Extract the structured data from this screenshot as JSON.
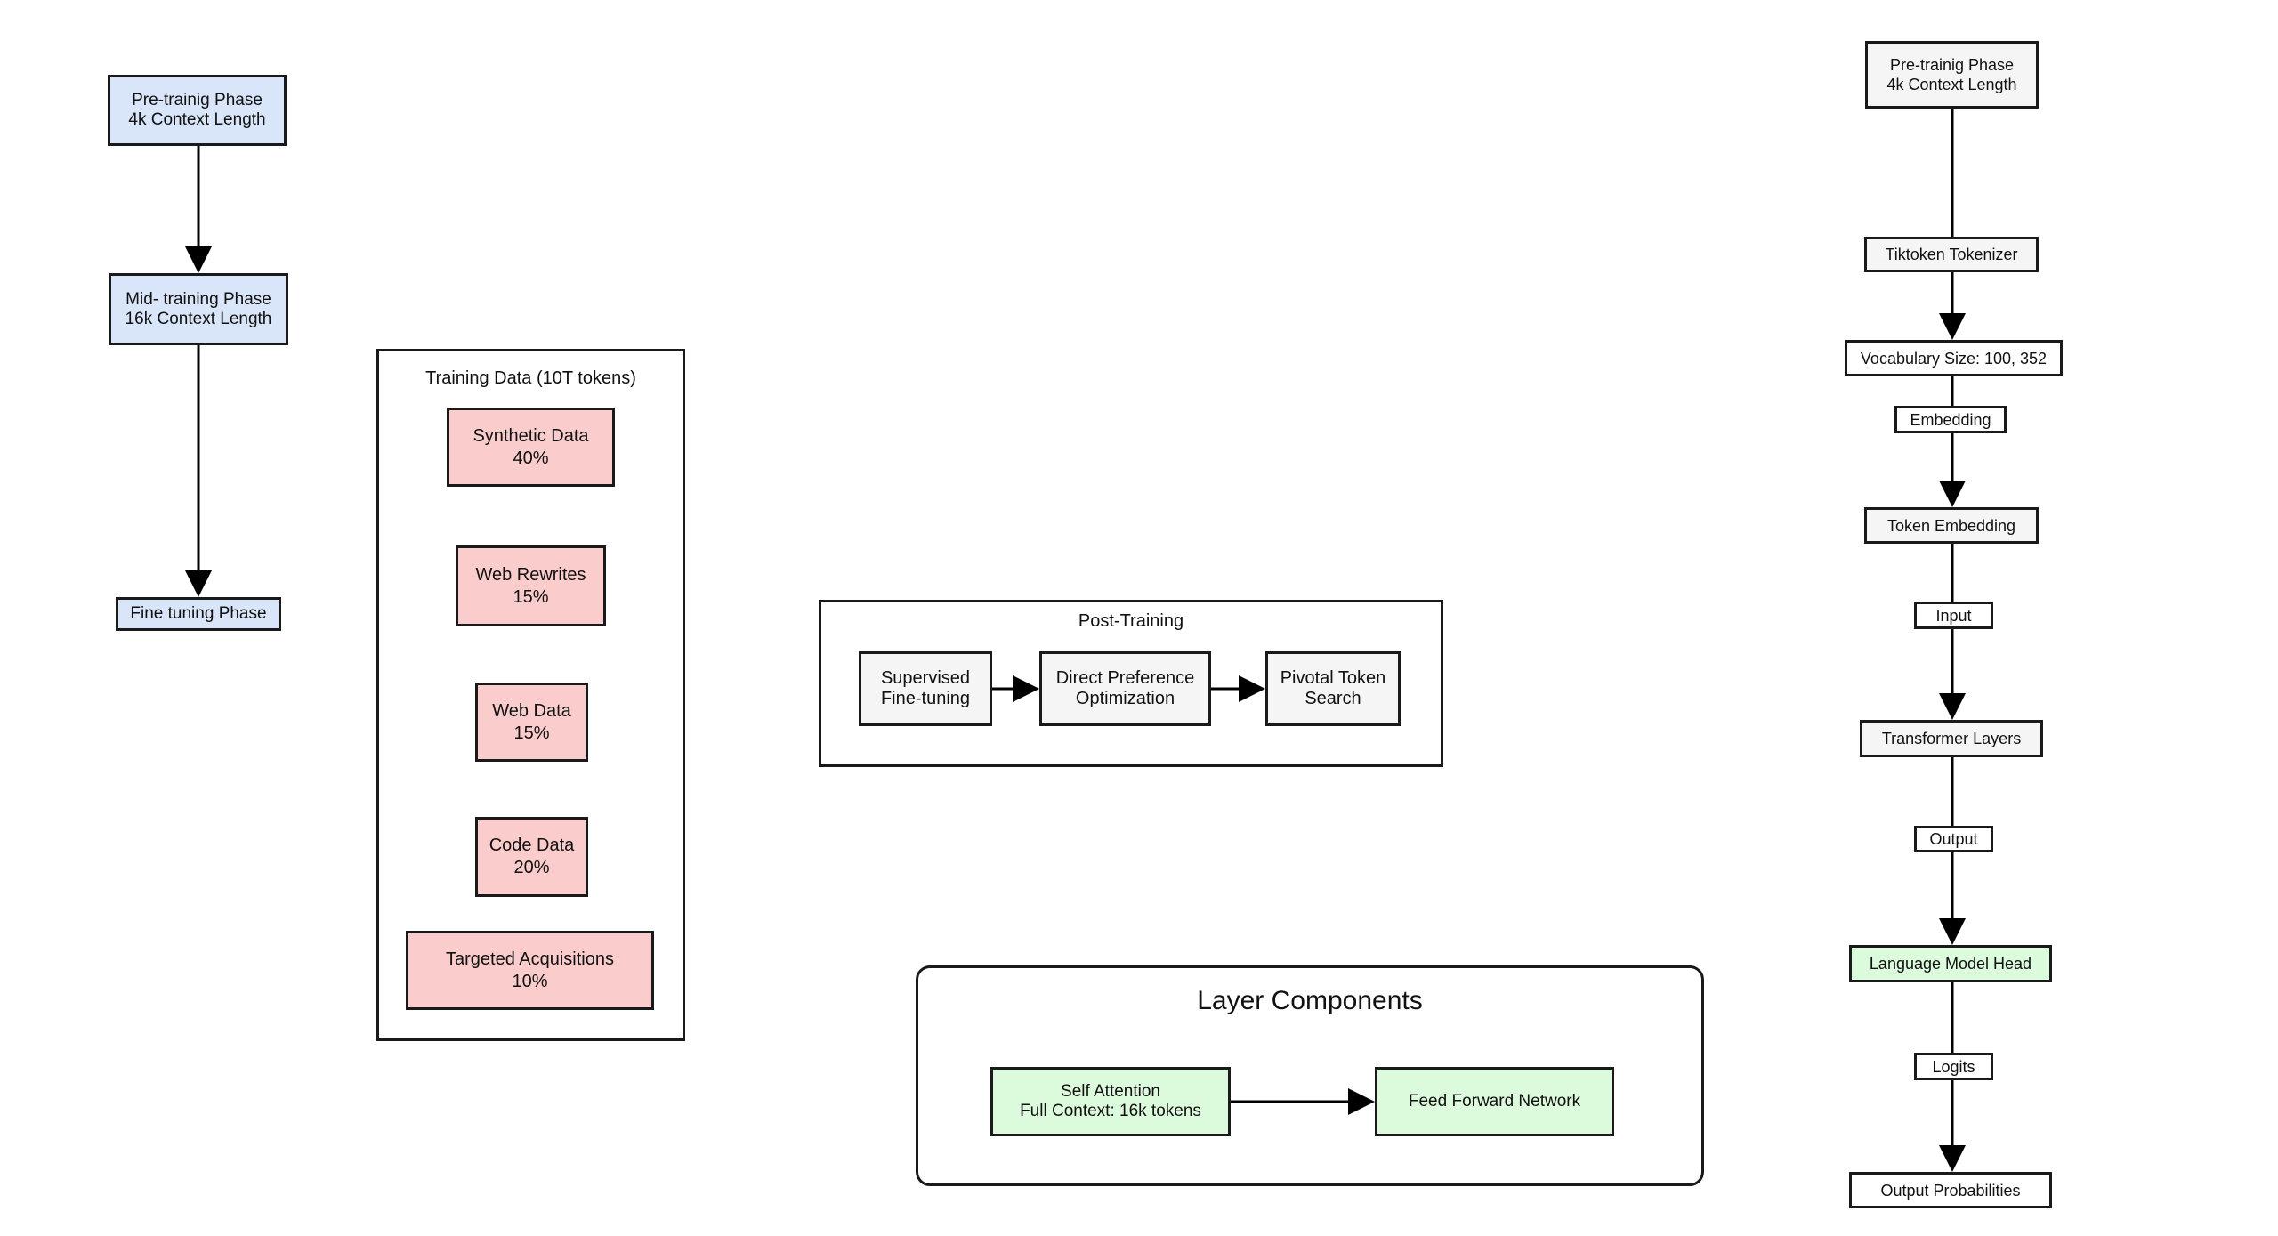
{
  "phases": {
    "pretraining": [
      "Pre-trainig Phase",
      "4k Context Length"
    ],
    "midtraining": [
      "Mid- training Phase",
      "16k Context Length"
    ],
    "finetuning": "Fine tuning Phase"
  },
  "training_data": {
    "title": "Training Data (10T tokens)",
    "items": [
      {
        "name": "Synthetic Data",
        "share": "40%"
      },
      {
        "name": "Web Rewrites",
        "share": "15%"
      },
      {
        "name": "Web Data",
        "share": "15%"
      },
      {
        "name": "Code Data",
        "share": "20%"
      },
      {
        "name": "Targeted Acquisitions",
        "share": "10%"
      }
    ]
  },
  "post_training": {
    "title": "Post-Training",
    "steps": [
      [
        "Supervised",
        "Fine-tuning"
      ],
      [
        "Direct Preference",
        "Optimization"
      ],
      [
        "Pivotal Token",
        "Search"
      ]
    ]
  },
  "layer_components": {
    "title": "Layer Components",
    "self_attention": [
      "Self Attention",
      "Full Context: 16k tokens"
    ],
    "ffn": "Feed Forward Network"
  },
  "pipeline": {
    "pretraining": [
      "Pre-trainig Phase",
      "4k Context Length"
    ],
    "tokenizer": "Tiktoken Tokenizer",
    "vocab": "Vocabulary Size: 100, 352",
    "embedding": "Embedding",
    "token_embedding": "Token Embedding",
    "input": "Input",
    "transformer": "Transformer Layers",
    "output": "Output",
    "lm_head": "Language Model Head",
    "logits": "Logits",
    "output_probs": "Output Probabilities"
  },
  "colors": {
    "phase": "#d9e5f8",
    "data": "#fbcccc",
    "component": "#dcfadc",
    "neutral": "#f5f5f5"
  }
}
